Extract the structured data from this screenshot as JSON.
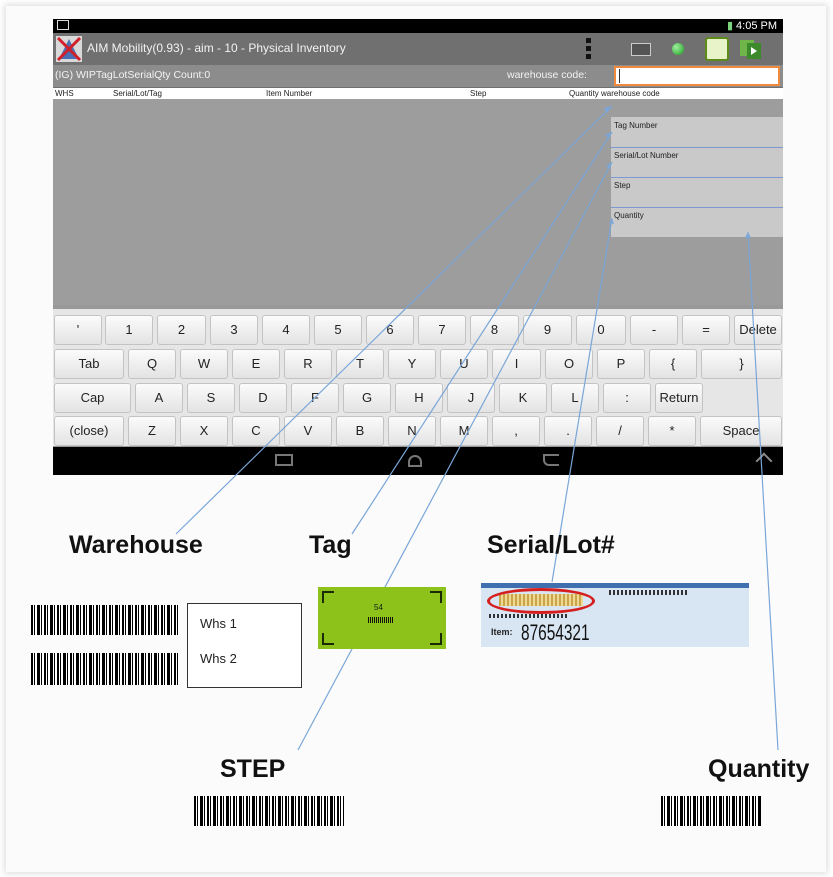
{
  "statusbar": {
    "time": "4:05 PM"
  },
  "app": {
    "title": "AIM Mobility(0.93) - aim - 10 - Physical Inventory"
  },
  "form": {
    "title": "(IG) WIPTagLotSerialQty  Count:0",
    "warehouse_label": "warehouse code:",
    "warehouse_value": ""
  },
  "columns": [
    "WHS",
    "Serial/Lot/Tag",
    "Item Number",
    "Step",
    "Quantity warehouse code"
  ],
  "side_fields": [
    "Tag Number",
    "Serial/Lot Number",
    "Step",
    "Quantity"
  ],
  "keyboard": {
    "row1": [
      "'",
      "1",
      "2",
      "3",
      "4",
      "5",
      "6",
      "7",
      "8",
      "9",
      "0",
      "-",
      "=",
      "Delete"
    ],
    "row2": [
      "Tab",
      "Q",
      "W",
      "E",
      "R",
      "T",
      "Y",
      "U",
      "I",
      "O",
      "P",
      "{",
      "}"
    ],
    "row3": [
      "Cap",
      "A",
      "S",
      "D",
      "F",
      "G",
      "H",
      "J",
      "K",
      "L",
      ":",
      "Return"
    ],
    "row4": [
      "(close)",
      "Z",
      "X",
      "C",
      "V",
      "B",
      "N",
      "M",
      ",",
      ".",
      "/",
      "*",
      "Space"
    ]
  },
  "labels": {
    "warehouse": "Warehouse",
    "tag": "Tag",
    "serial": "Serial/Lot#",
    "step": "STEP",
    "quantity": "Quantity"
  },
  "whs_options": [
    "Whs 1",
    "Whs 2"
  ],
  "tag_card": {
    "number": "54"
  },
  "serial_card": {
    "item_label": "Item:",
    "item_number": "87654321"
  },
  "colors": {
    "accent_input_border": "#f08a3c",
    "callout_line": "#7aa6d8",
    "oval": "#d51f1f",
    "tag_green": "#8cc21a"
  },
  "icons": [
    "app-logo-icon",
    "overflow-menu-icon",
    "keyboard-icon",
    "status-dot-icon",
    "edit-icon",
    "sync-icon",
    "back-icon",
    "home-icon",
    "recent-apps-icon",
    "chevron-up-icon"
  ]
}
